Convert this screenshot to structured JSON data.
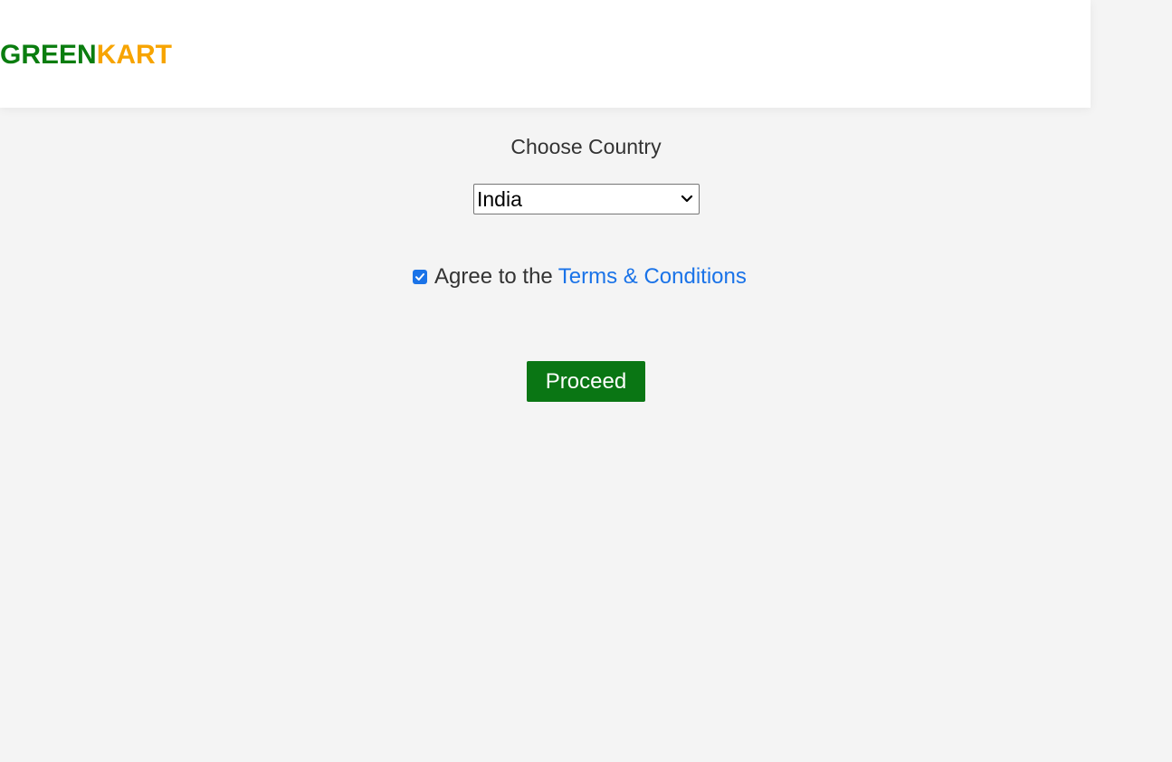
{
  "header": {
    "brand_part1": "GREEN",
    "brand_part2": "KART",
    "brand_color_green": "#0a7d0f",
    "brand_color_orange": "#f7a400"
  },
  "form": {
    "choose_country_label": "Choose Country",
    "country_selected": "India",
    "agree_checked": true,
    "agree_text": "Agree to the",
    "terms_link": "Terms & Conditions",
    "proceed_label": "Proceed",
    "accent_color": "#1a73e8",
    "button_color": "#0a7614"
  },
  "icons": {
    "dropdown": "chevron-down-icon",
    "checkbox": "checkmark-icon"
  }
}
